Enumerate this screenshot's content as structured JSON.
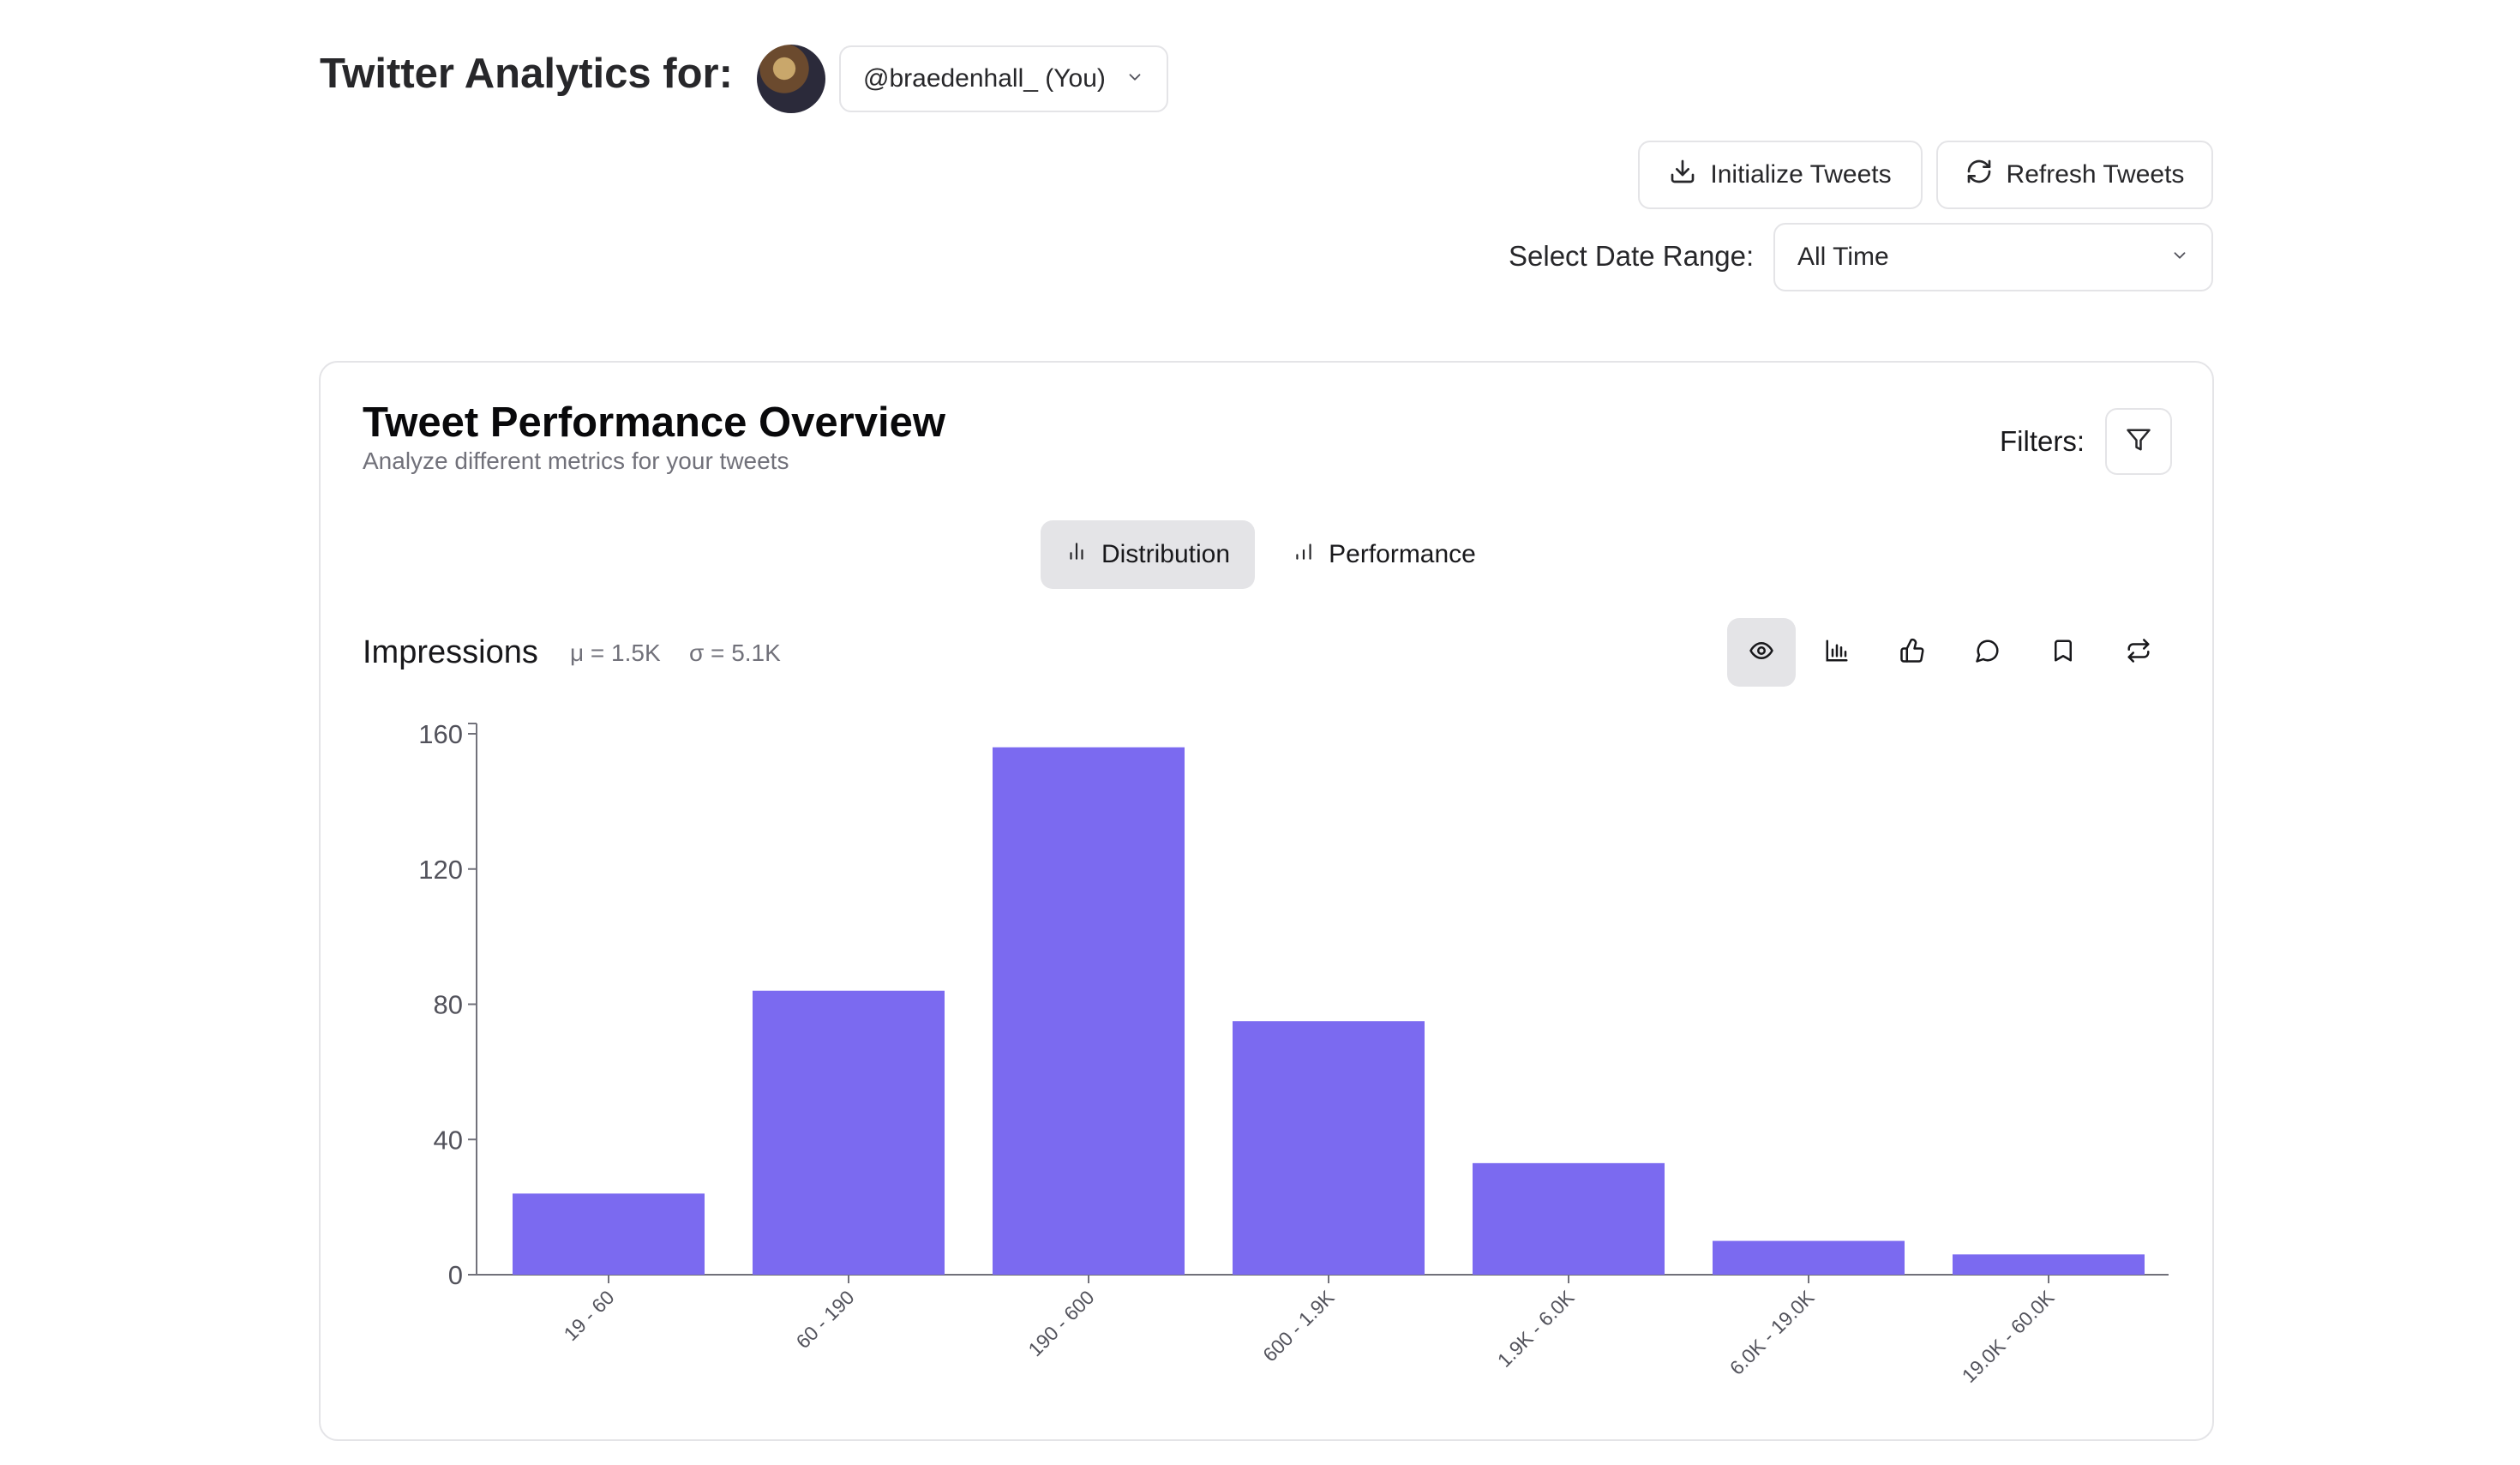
{
  "header": {
    "title": "Twitter Analytics for:",
    "account": "@braedenhall_ (You)",
    "initialize_label": "Initialize Tweets",
    "refresh_label": "Refresh Tweets",
    "date_label": "Select Date Range:",
    "date_value": "All Time"
  },
  "card": {
    "title": "Tweet Performance Overview",
    "subtitle": "Analyze different metrics for your tweets",
    "filters_label": "Filters:"
  },
  "tabs": [
    {
      "label": "Distribution",
      "active": true
    },
    {
      "label": "Performance",
      "active": false
    }
  ],
  "metric": {
    "name": "Impressions",
    "mean": "μ = 1.5K",
    "std": "σ = 5.1K"
  },
  "metric_icons": [
    "eye-icon",
    "bar-chart-icon",
    "thumbs-up-icon",
    "message-circle-icon",
    "bookmark-icon",
    "repeat-icon"
  ],
  "colors": {
    "bar": "#7b6af0",
    "active_bg": "#e4e4e7",
    "muted_text": "#71717a",
    "border": "#e4e4e7"
  },
  "chart_data": {
    "type": "bar",
    "categories": [
      "19 - 60",
      "60 - 190",
      "190 - 600",
      "600 - 1.9K",
      "1.9K - 6.0K",
      "6.0K - 19.0K",
      "19.0K - 60.0K"
    ],
    "values": [
      24,
      84,
      156,
      75,
      33,
      10,
      6
    ],
    "ylim": [
      0,
      160
    ],
    "yticks": [
      "0",
      "40",
      "80",
      "120",
      "160"
    ],
    "grid": false,
    "xlabel": "",
    "ylabel": ""
  }
}
